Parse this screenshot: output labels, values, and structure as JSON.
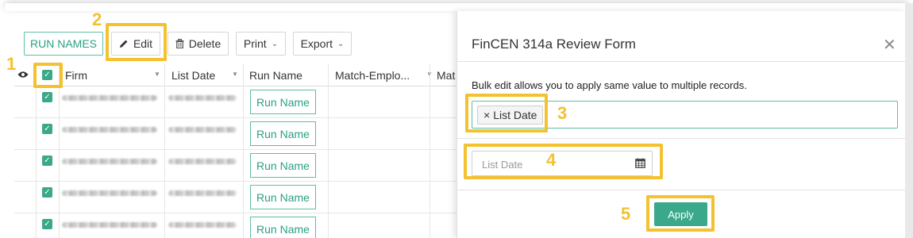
{
  "toolbar": {
    "run_names_label": "RUN NAMES",
    "edit_label": "Edit",
    "delete_label": "Delete",
    "print_label": "Print",
    "export_label": "Export"
  },
  "table": {
    "columns": [
      "Firm",
      "List Date",
      "Run Name",
      "Match-Emplo...",
      "Mat"
    ],
    "rows": [
      {
        "run_name": "Run Name"
      },
      {
        "run_name": "Run Name"
      },
      {
        "run_name": "Run Name"
      },
      {
        "run_name": "Run Name"
      },
      {
        "run_name": "Run Name"
      }
    ]
  },
  "drawer": {
    "title": "FinCEN 314a Review Form",
    "info": "Bulk edit allows you to apply same value to multiple records.",
    "selected_field_tag": "List Date",
    "tag_remove_symbol": "×",
    "date_placeholder": "List Date",
    "date_value": "",
    "apply_label": "Apply",
    "close_symbol": "✕"
  },
  "annotations": {
    "numbers": [
      "1",
      "2",
      "3",
      "4",
      "5"
    ],
    "color": "#f4c12f"
  },
  "colors": {
    "accent": "#3aa88a",
    "accent_text": "#2aa084"
  }
}
